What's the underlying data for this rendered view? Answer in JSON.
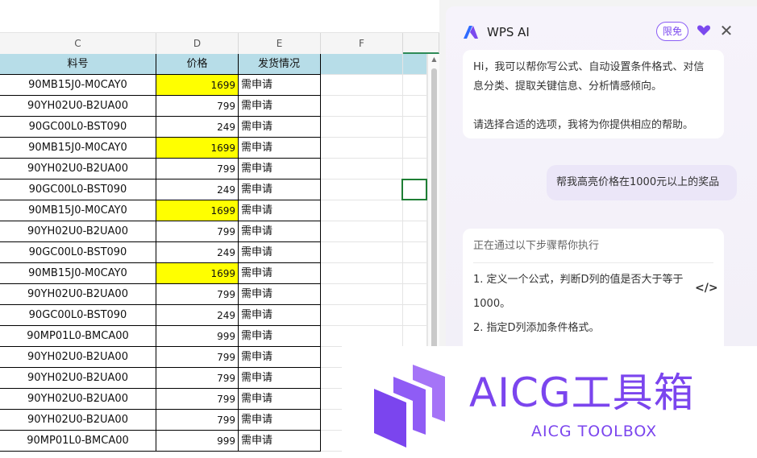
{
  "spreadsheet": {
    "columns": [
      "C",
      "D",
      "E",
      "F",
      ""
    ],
    "header_row": {
      "c": "料号",
      "d": "价格",
      "e": "发货情况"
    },
    "rows": [
      {
        "c": "90MB15J0-M0CAY0",
        "d": "1699",
        "e": "需申请",
        "highlight": true
      },
      {
        "c": "90YH02U0-B2UA00",
        "d": "799",
        "e": "需申请",
        "highlight": false
      },
      {
        "c": "90GC00L0-BST090",
        "d": "249",
        "e": "需申请",
        "highlight": false
      },
      {
        "c": "90MB15J0-M0CAY0",
        "d": "1699",
        "e": "需申请",
        "highlight": true
      },
      {
        "c": "90YH02U0-B2UA00",
        "d": "799",
        "e": "需申请",
        "highlight": false
      },
      {
        "c": "90GC00L0-BST090",
        "d": "249",
        "e": "需申请",
        "highlight": false
      },
      {
        "c": "90MB15J0-M0CAY0",
        "d": "1699",
        "e": "需申请",
        "highlight": true
      },
      {
        "c": "90YH02U0-B2UA00",
        "d": "799",
        "e": "需申请",
        "highlight": false
      },
      {
        "c": "90GC00L0-BST090",
        "d": "249",
        "e": "需申请",
        "highlight": false
      },
      {
        "c": "90MB15J0-M0CAY0",
        "d": "1699",
        "e": "需申请",
        "highlight": true
      },
      {
        "c": "90YH02U0-B2UA00",
        "d": "799",
        "e": "需申请",
        "highlight": false
      },
      {
        "c": "90GC00L0-BST090",
        "d": "249",
        "e": "需申请",
        "highlight": false
      },
      {
        "c": "90MP01L0-BMCA00",
        "d": "999",
        "e": "需申请",
        "highlight": false
      },
      {
        "c": "90YH02U0-B2UA00",
        "d": "799",
        "e": "需申请",
        "highlight": false
      },
      {
        "c": "90YH02U0-B2UA00",
        "d": "799",
        "e": "需申请",
        "highlight": false
      },
      {
        "c": "90YH02U0-B2UA00",
        "d": "799",
        "e": "需申请",
        "highlight": false
      },
      {
        "c": "90YH02U0-B2UA00",
        "d": "799",
        "e": "需申请",
        "highlight": false
      },
      {
        "c": "90MP01L0-BMCA00",
        "d": "999",
        "e": "需申请",
        "highlight": false
      }
    ],
    "header_fill": "#b7dde8",
    "highlight_fill": "#ffff00"
  },
  "ai_panel": {
    "title": "WPS AI",
    "badge": "限免",
    "icons": {
      "logo": "wps-ai-logo",
      "heart": "heart-hand-icon",
      "close": "close-icon",
      "code": "code-icon"
    },
    "greeting_line1": "Hi，我可以帮你写公式、自动设置条件格式、对信息分类、提取关键信息、分析情感倾向。",
    "greeting_line2": "请选择合适的选项，我将为你提供相应的帮助。",
    "user_message": "帮我高亮价格在1000元以上的奖品",
    "steps_title": "正在通过以下步骤帮你执行",
    "step1": "1. 定义一个公式，判断D列的值是否大于等于1000。",
    "step2": "2. 指定D列添加条件格式。",
    "accent_color": "#7b49ee"
  },
  "watermark": {
    "title": "AICG工具箱",
    "subtitle": "AICG TOOLBOX",
    "color": "#7b45ee"
  }
}
